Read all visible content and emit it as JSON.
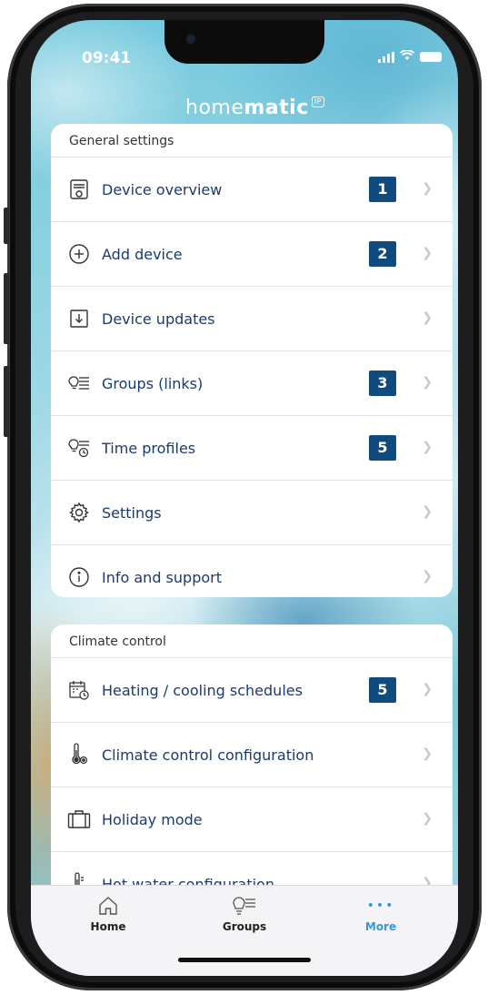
{
  "status": {
    "time": "09:41"
  },
  "brand": {
    "light": "home",
    "bold": "matic",
    "suffix": "IP"
  },
  "general": {
    "title": "General settings",
    "items": [
      {
        "label": "Device overview",
        "badge": "1",
        "icon": "device-overview-icon"
      },
      {
        "label": "Add device",
        "badge": "2",
        "icon": "plus-circle-icon"
      },
      {
        "label": "Device updates",
        "badge": "",
        "icon": "download-box-icon"
      },
      {
        "label": "Groups (links)",
        "badge": "3",
        "icon": "bulb-list-icon"
      },
      {
        "label": "Time profiles",
        "badge": "5",
        "icon": "bulb-clock-icon"
      },
      {
        "label": "Settings",
        "badge": "",
        "icon": "gear-icon"
      },
      {
        "label": "Info and support",
        "badge": "",
        "icon": "info-icon"
      }
    ]
  },
  "climate": {
    "title": "Climate control",
    "items": [
      {
        "label": "Heating / cooling schedules",
        "badge": "5",
        "icon": "calendar-clock-icon"
      },
      {
        "label": "Climate control configuration",
        "badge": "",
        "icon": "thermometer-gear-icon"
      },
      {
        "label": "Holiday mode",
        "badge": "",
        "icon": "suitcase-icon"
      },
      {
        "label": "Hot water configuration",
        "badge": "",
        "icon": "thermometer-icon"
      }
    ]
  },
  "tabs": [
    {
      "label": "Home",
      "icon": "home-icon"
    },
    {
      "label": "Groups",
      "icon": "bulb-list-icon"
    },
    {
      "label": "More",
      "icon": "more-dots-icon",
      "active": true
    }
  ],
  "colors": {
    "accent": "#3a97d4",
    "badge": "#114a7c",
    "label": "#1a3b6e"
  }
}
